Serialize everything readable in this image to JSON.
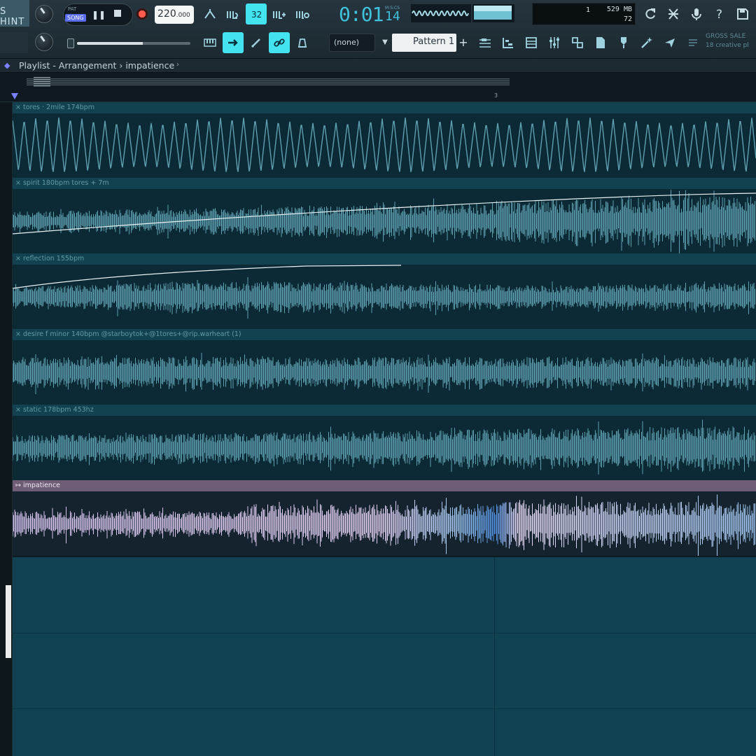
{
  "toolbar": {
    "menu_label": "S HINT",
    "transport_mode_pat": "PAT",
    "transport_mode_song": "SONG",
    "tempo_main": "220",
    "tempo_dec": ".000",
    "time_main": "0:01",
    "time_sub": "14",
    "time_unit": "M:S:CS",
    "memory_poly": "1",
    "memory_mb": "529 MB",
    "memory_cpu": "72",
    "pattern_none": "(none)",
    "pattern_name": "Pattern 1",
    "news_line1": "GROSS SALE",
    "news_line2": "18 creative pl",
    "icons": {
      "snap": "snap-icon",
      "step": "step-edit-icon",
      "blend": "blend-icon",
      "typing": "typing-keyboard-icon",
      "metronome": "metronome-icon",
      "loop": "loop-record-icon",
      "piano": "piano-roll-icon",
      "redo": "arrow-right-icon",
      "pencil": "pencil-icon",
      "link": "link-icon",
      "bell": "bell-icon",
      "playlist": "playlist-icon",
      "channel_rack": "channel-rack-icon",
      "mixer": "mixer-icon",
      "plugin": "plugin-picker-icon",
      "browser": "browser-icon",
      "picker": "picker-icon",
      "wand": "wand-icon",
      "cloud": "cloud-icon",
      "refresh": "refresh-icon",
      "cut": "cut-icon",
      "mic": "microphone-icon",
      "help": "help-icon",
      "save": "save-icon"
    },
    "accent_color": "#43e3f0"
  },
  "playlist": {
    "title": "Playlist - Arrangement › impatience",
    "dropdown": "›",
    "bar_marker": "3",
    "colors": {
      "track_wave": "#5e9fb0",
      "selected_wave_a": "#d4c2ee",
      "selected_wave_b": "#9fc6f0",
      "empty_bg": "#114252"
    },
    "tracks": [
      {
        "label": "× tores · 2mile 174bpm",
        "selected": false,
        "automation": "none",
        "shape": "saw"
      },
      {
        "label": "× spirit 180bpm tores + 7m",
        "selected": false,
        "automation": "rising",
        "shape": "noise_grow"
      },
      {
        "label": "× reflection 155bpm",
        "selected": false,
        "automation": "curve",
        "shape": "noise_mid"
      },
      {
        "label": "× desire f minor 140bpm @starboytok+@1tores+@rip.warheart (1)",
        "selected": false,
        "automation": "none",
        "shape": "noise_spiky"
      },
      {
        "label": "× static 178bpm 453hz",
        "selected": false,
        "automation": "none",
        "shape": "noise_grow2"
      },
      {
        "label": "↦ impatience",
        "selected": true,
        "automation": "none",
        "shape": "noise_selected"
      }
    ]
  }
}
